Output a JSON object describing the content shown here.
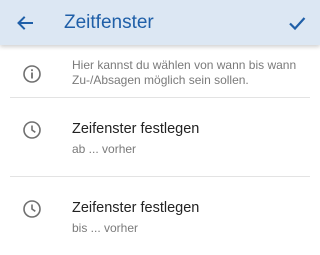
{
  "appbar": {
    "title": "Zeitfenster",
    "back_icon": "arrow-left-icon",
    "confirm_icon": "check-icon",
    "accent": "#1f5fa8",
    "background": "#dce7f3"
  },
  "info": {
    "icon": "info-icon",
    "text": "Hier kannst du wählen von wann bis wann Zu-/Absagen möglich sein sollen."
  },
  "settings": [
    {
      "icon": "clock-icon",
      "label": "Zeifenster festlegen",
      "value": "ab ... vorher"
    },
    {
      "icon": "clock-icon",
      "label": "Zeifenster festlegen",
      "value": "bis ... vorher"
    }
  ]
}
